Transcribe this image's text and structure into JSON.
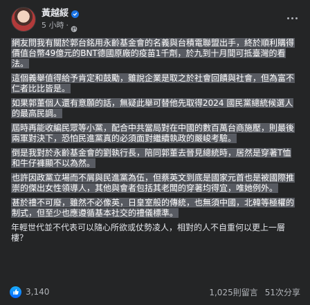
{
  "post": {
    "author": "黃越綏",
    "time": "5 小時",
    "separator": "·",
    "paragraphs": [
      "網友問我有關於郭台銘用永齡基金會的名義與台積電聯盟出手，終於順利購得價值台幣49億元的BNT德國原廠的疫苗1千劑，於九到十月間可抵臺灣的看法。",
      "這個義舉值得給予肯定和鼓勵，雖說企業是取之於社會回饋與社會，但為富不仁者比比皆是。",
      "如果郭董個人還有意願的話，無疑此舉可替他先取得2024 國民黨總統候選人的最高民調。",
      "屆時再能收編民眾等小黨，配合中共當局對在中國的數百萬台商施壓，則最後兩軍對決下，恐怕民進黨真的必須面對繼續執政的嚴峻考驗。",
      "倒是我對於永齡基金會的劉執行長，陪同郭董去晉見總統時，居然是穿著T恤和牛仔褲顯不以為然。",
      "也許因政黨立場而不屑與民進黨為伍，但蔡英文到底是國家元首也是被國際推崇的傑出女性領導人，其他與會者包括其老闆的穿著均得宜，唯她例外。",
      "甚於禮不可廢，雖然不必像英，日皇室般的傳統，也無須中國，北韓等極權的制式，但至少也應遵循基本社交的禮儀標準。",
      "年輕世代並不代表可以隨心所欲或仗勢凌人，相對的人不自重何以更上一層樓？"
    ]
  },
  "stats": {
    "likes": "3,140",
    "comments": "1,025則留言",
    "shares": "51次分享"
  },
  "colors": {
    "background": "#242526",
    "text": "#e4e6eb",
    "secondary_text": "#b0b3b8",
    "accent": "#1b74e4"
  },
  "icons": {
    "verified": "verified-badge-icon",
    "privacy": "globe-icon",
    "like": "thumbs-up-icon",
    "more": "more-options-icon"
  }
}
